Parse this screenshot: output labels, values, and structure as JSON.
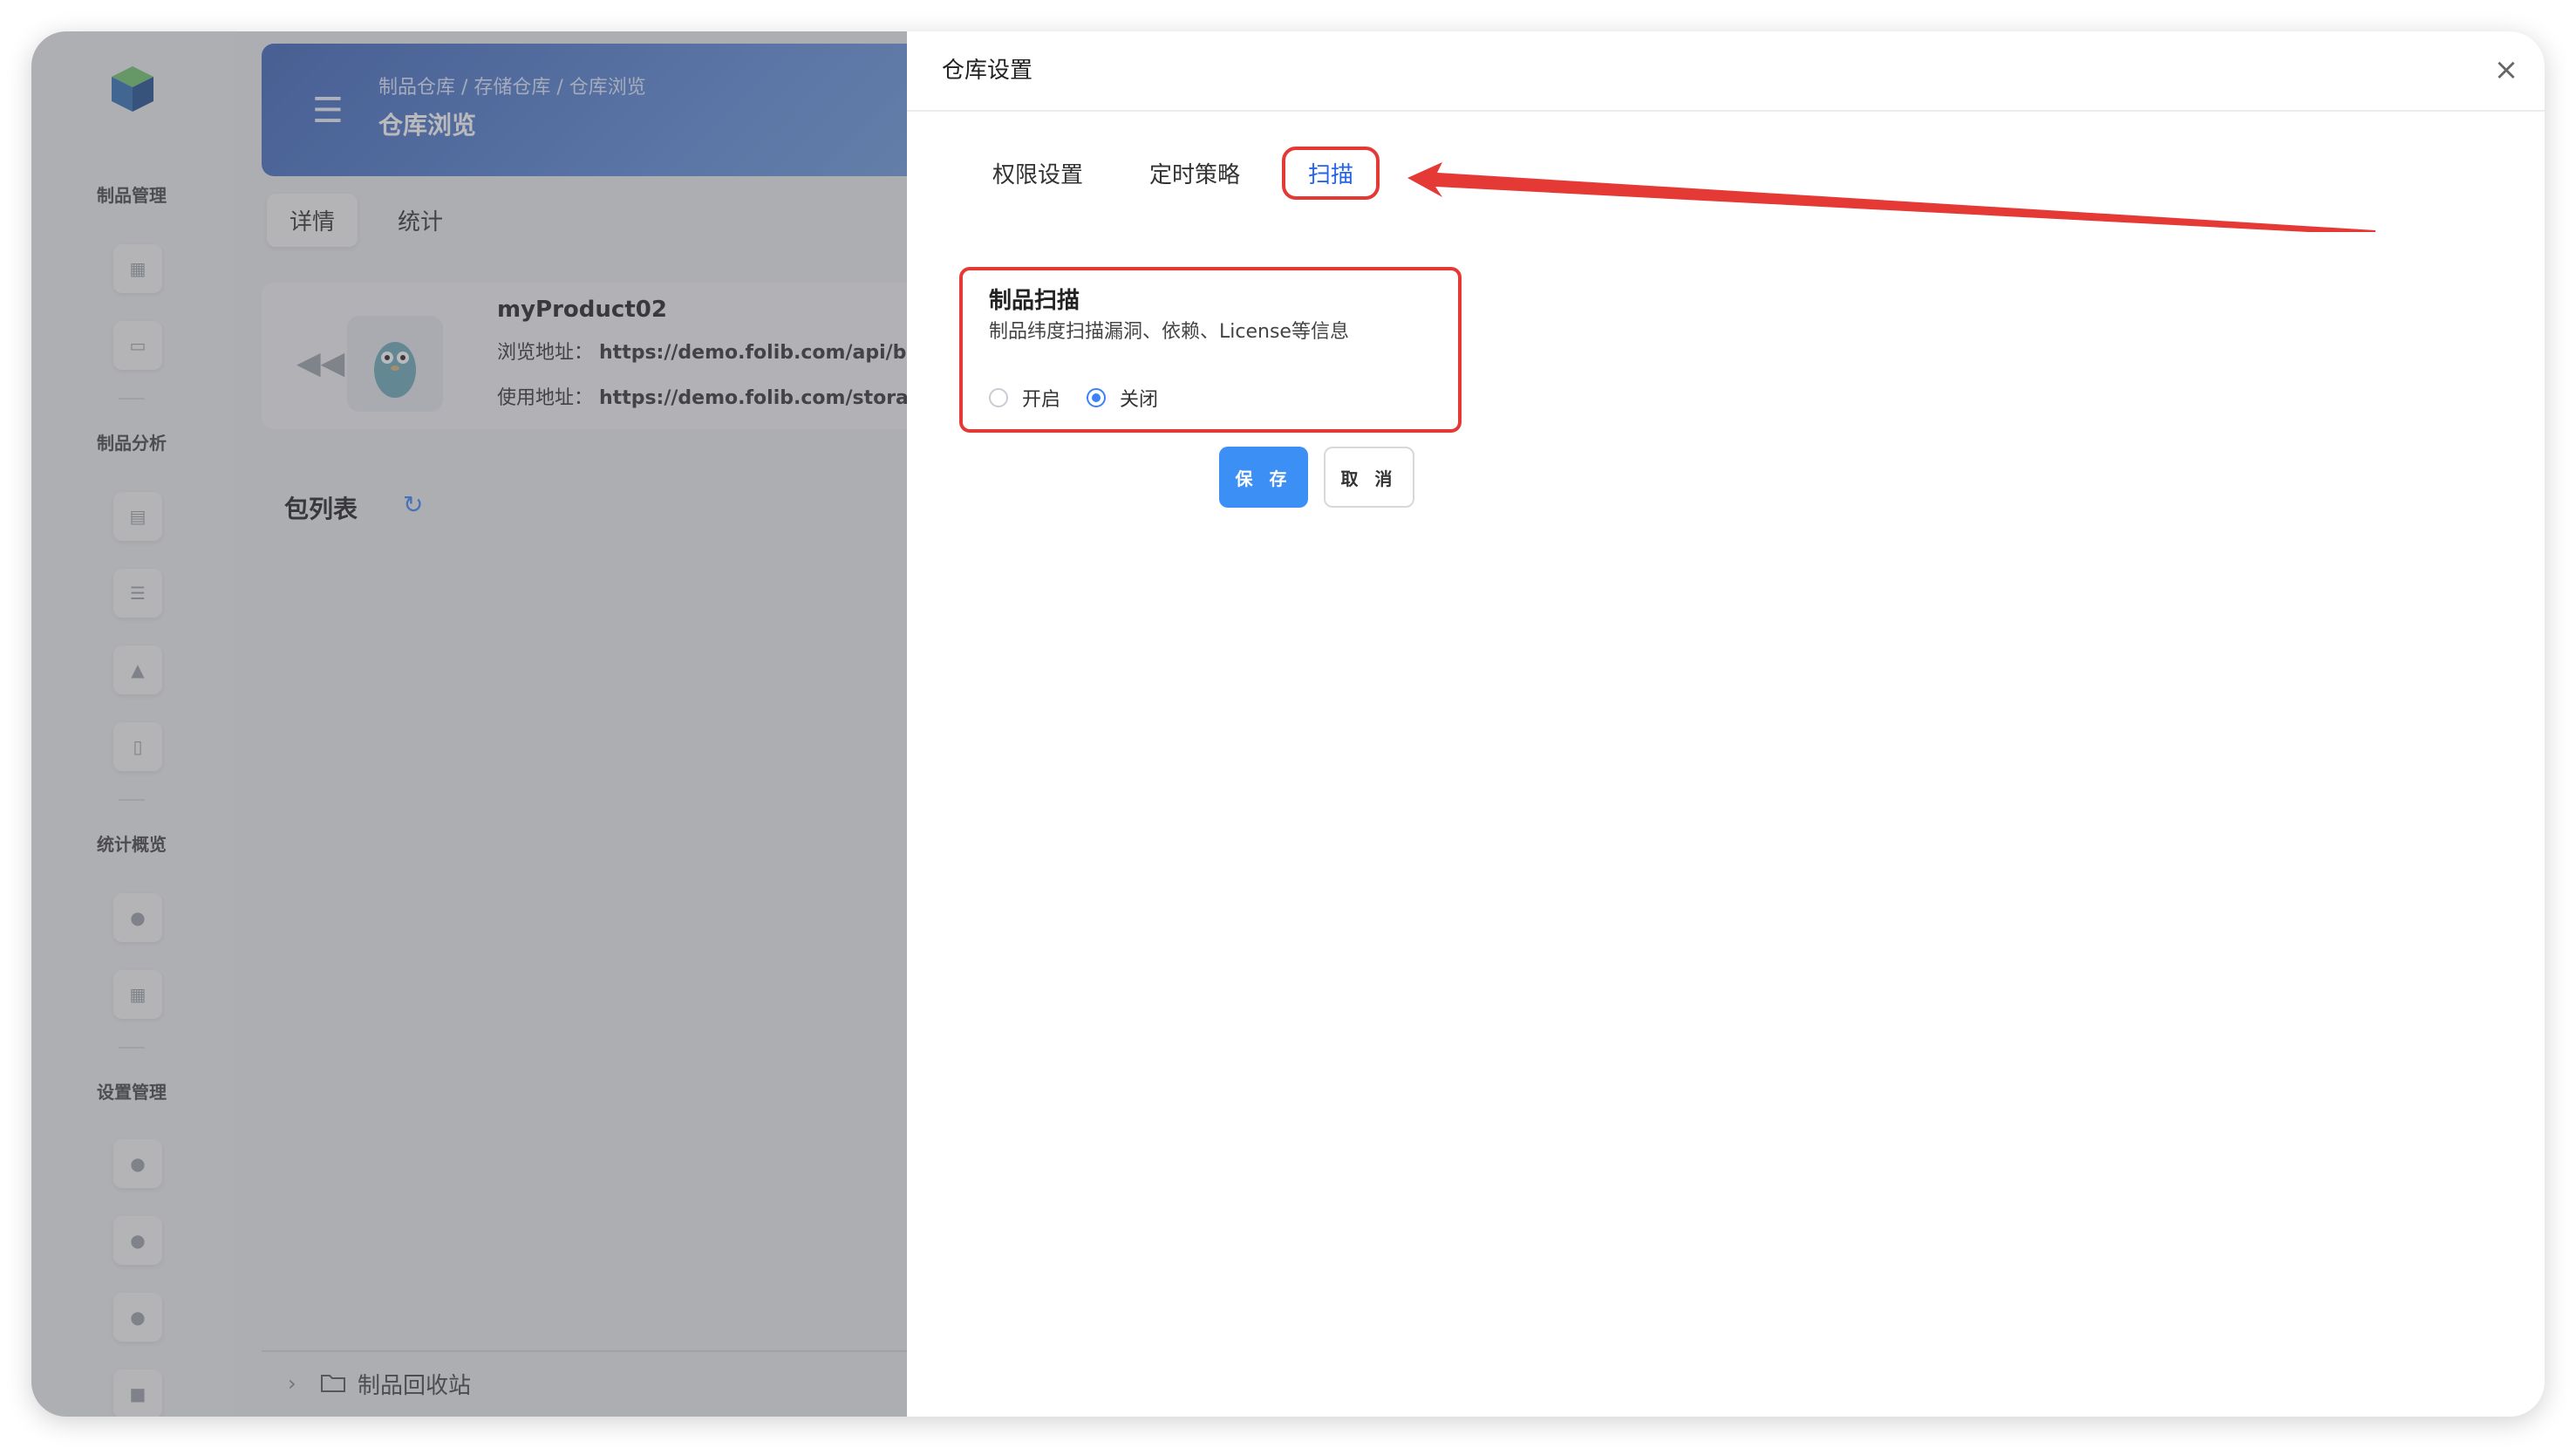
{
  "sidebar": {
    "sections": [
      "制品管理",
      "制品分析",
      "统计概览",
      "设置管理"
    ]
  },
  "banner": {
    "breadcrumb": "制品仓库  /  存储仓库  /  仓库浏览",
    "title": "仓库浏览"
  },
  "main_tabs": [
    "详情",
    "统计"
  ],
  "product": {
    "name": "myProduct02",
    "browse_label": "浏览地址：",
    "browse_url": "https://demo.folib.com/api/browse/V",
    "use_label": "使用地址：",
    "use_url": "https://demo.folib.com/storages/Wa"
  },
  "package_list_title": "包列表",
  "recycle_label": "制品回收站",
  "drawer": {
    "title": "仓库设置",
    "tabs": [
      "权限设置",
      "定时策略",
      "扫描"
    ],
    "scan": {
      "title": "制品扫描",
      "description": "制品纬度扫描漏洞、依赖、License等信息",
      "option_on": "开启",
      "option_off": "关闭",
      "selected": "关闭"
    },
    "save_label": "保 存",
    "cancel_label": "取 消"
  },
  "colors": {
    "primary": "#3b8ff5",
    "highlight": "#e53935"
  }
}
